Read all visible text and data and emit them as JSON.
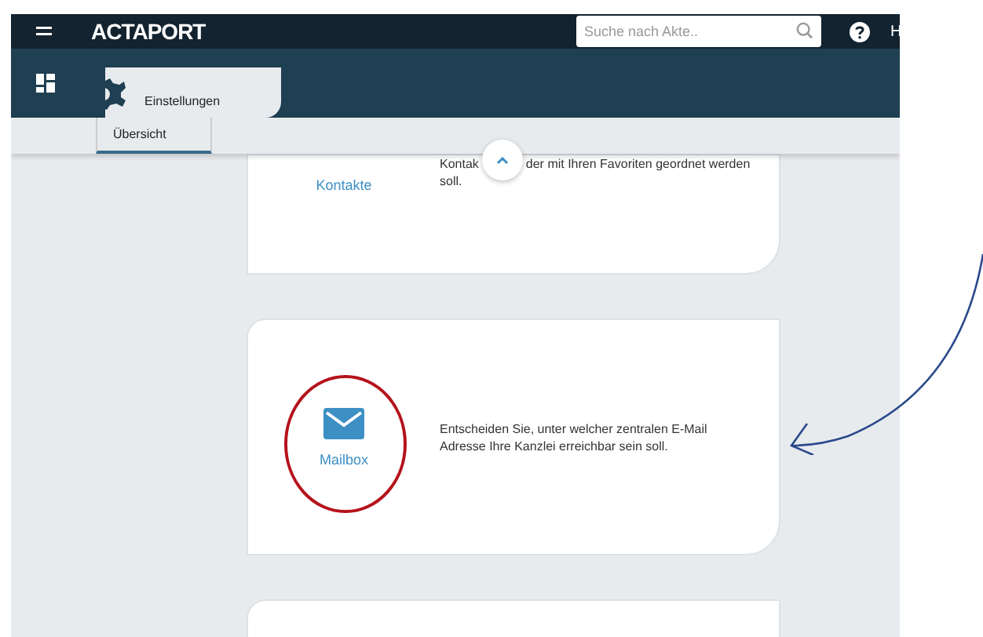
{
  "header": {
    "logo": "ACTAPORT",
    "search": {
      "placeholder": "Suche nach Akte.."
    },
    "user_initial": "H"
  },
  "nav": {
    "tabs": [
      {
        "label": "Einstellungen",
        "selected": true
      }
    ]
  },
  "subtabs": [
    {
      "label": "Übersicht",
      "selected": true
    }
  ],
  "cards": [
    {
      "kind": "contacts",
      "label": "Kontakte",
      "description": [
        "Kontak",
        "der mit Ihren Favoriten geordnet werden soll."
      ],
      "highlighted": false
    },
    {
      "kind": "mail",
      "label": "Mailbox",
      "description": [
        "Entscheiden Sie, unter welcher zentralen E-Mail Adresse Ihre Kanzlei erreichbar sein soll."
      ],
      "highlighted": true
    },
    {
      "kind": "empty"
    }
  ]
}
